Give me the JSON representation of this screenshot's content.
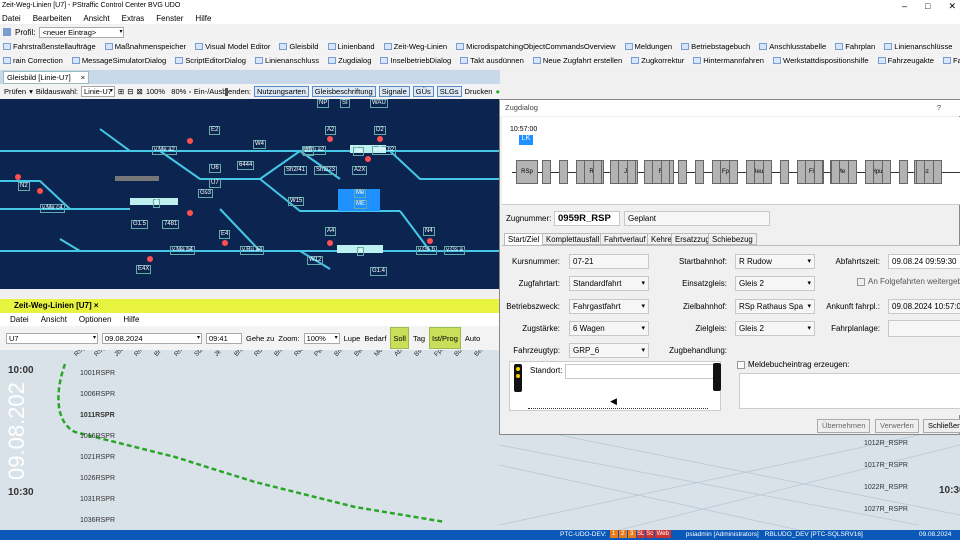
{
  "app": {
    "title": "Zeit-Weg-Linien [U7] - PStraffic Control Center BVG UDO"
  },
  "menubar": [
    "Datei",
    "Bearbeiten",
    "Ansicht",
    "Extras",
    "Fenster",
    "Hilfe"
  ],
  "profile": {
    "label": "Profil:",
    "value": "<neuer Eintrag>"
  },
  "toolbar1": [
    "Fahrstraßenstellaufträge",
    "Maßnahmenspeicher",
    "Visual Model Editor",
    "Gleisbild",
    "Linienband",
    "Zeit-Weg-Linien",
    "MicrodispatchingObjectCommandsOverview",
    "Meldungen",
    "Betriebstagebuch",
    "Anschlusstabelle",
    "Fahrplan",
    "Linienanschlüsse",
    "Linienübersicht",
    "Umlaufplan"
  ],
  "toolbar2": [
    "rain Correction",
    "MessageSimulatorDialog",
    "ScriptEditorDialog",
    "Linienanschluss",
    "Zugdialog",
    "InselbetriebDialog",
    "Takt ausdünnen",
    "Neue Zugfahrt erstellen",
    "Zugkorrektur",
    "Hintermannfahren",
    "Werkstattdispositionshilfe",
    "Fahrzeugakte",
    "Fahrzeugtyp",
    "Traktionstypmuster"
  ],
  "gleisbild": {
    "tab": "Gleisbild [Linie-U7]",
    "pruefen": "Prüfen",
    "bildauswahl_label": "Bildauswahl:",
    "bildauswahl": "Linie-U7",
    "zoom1": "100%",
    "zoom2": "80%",
    "einaus": "Ein-/Ausblenden:",
    "buttons": [
      "Nutzungsarten",
      "Gleisbeschriftung",
      "Signale",
      "GÜs",
      "SLGs"
    ],
    "drucken": "Drucken"
  },
  "track_labels": [
    "v.Me a2",
    "v.Ru a2",
    "v.Ru b2",
    "v.Me b4",
    "v.Ru a4",
    "v.Gs b",
    "v.Gs a",
    "v.Me c4",
    "2a",
    "2b",
    "4",
    "5",
    "Me",
    "ME",
    "W4",
    "W15",
    "W12",
    "Gs3",
    "Sh2/41",
    "Sh2/23",
    "A2X",
    "E2",
    "E4",
    "A2",
    "D2",
    "N2",
    "A4",
    "N4",
    "E4X",
    "U6",
    "U7",
    "6444",
    "7481",
    "G1.5",
    "G1.4",
    "NP",
    "SI",
    "WAU"
  ],
  "zwl": {
    "title": "Zeit-Weg-Linien [U7]",
    "menu": [
      "Datei",
      "Ansicht",
      "Optionen",
      "Hilfe"
    ],
    "line": "U7",
    "date": "09.08.2024",
    "time": "09:41",
    "gehe_zu": "Gehe zu",
    "zoom_label": "Zoom:",
    "zoom": "100%",
    "tools": [
      "Lupe",
      "Bedarf",
      "Soll",
      "Tag",
      "Ist/Prog",
      "Auto"
    ],
    "stations": [
      "RSp",
      "RSp",
      "Jbw",
      "Rmu",
      "Br",
      "Rn",
      "Sta",
      "Jk",
      "Bhf",
      "Rb",
      "Bmk",
      "Rw",
      "Pw",
      "Bmu",
      "Bw",
      "Mc",
      "Ab",
      "Bs",
      "Fpu",
      "Bu",
      "Beu"
    ],
    "date_big": "09.08.202",
    "time_marks": [
      "10:00",
      "10:30"
    ],
    "trains": [
      "1001RSPR",
      "1006RSPR",
      "1011RSPR",
      "1016RSPR",
      "1021RSPR",
      "1026RSPR",
      "1031RSPR",
      "1036RSPR"
    ],
    "right_trains": [
      "1012R_RSPR",
      "1017R_RSPR",
      "1022R_RSPR",
      "1027R_RSPR"
    ],
    "right_date": "09.08.2024",
    "right_time": "10:30"
  },
  "dialog": {
    "title": "Zugdialog",
    "time": "10:57:00",
    "badge": "LK",
    "route_stations": [
      "RSp",
      "Rs",
      "Jk",
      "Rw",
      "Fpu",
      "Beu",
      "Flu",
      "Me",
      "Hpu",
      "Gz"
    ],
    "zugnummer_label": "Zugnummer:",
    "zugnummer": "0959R_RSP",
    "status": "Geplant",
    "tabs": [
      "Start/Ziel",
      "Komplettausfall",
      "Fahrtverlauf",
      "Kehre",
      "Ersatzzug",
      "Schiebezug"
    ],
    "fields": {
      "kursnummer_l": "Kursnummer:",
      "kursnummer": "07-21",
      "zugfahrtart_l": "Zugfahrtart:",
      "zugfahrtart": "Standardfahrt",
      "betriebszweck_l": "Betriebszweck:",
      "betriebszweck": "Fahrgastfahrt",
      "zugstaerke_l": "Zugstärke:",
      "zugstaerke": "6 Wagen",
      "fahrzeugtyp_l": "Fahrzeugtyp:",
      "fahrzeugtyp": "GRP_6",
      "startbahnhof_l": "Startbahnhof:",
      "startbahnhof": "R  Rudow",
      "einsatzgleis_l": "Einsatzgleis:",
      "einsatzgleis": "Gleis 2",
      "zielbahnhof_l": "Zielbahnhof:",
      "zielbahnhof": "RSp  Rathaus Spa",
      "zielgleis_l": "Zielgleis:",
      "zielgleis": "Gleis 2",
      "zugbehandlung_l": "Zugbehandlung:",
      "abfahrtszeit_l": "Abfahrtszeit:",
      "abfahrtszeit": "09.08.24 09:59:30",
      "folgefahrten": "An Folgefahrten weitergeb",
      "ankunft_l": "Ankunft fahrpl.:",
      "ankunft": "09.08.2024 10:57:00",
      "fahrplanlage_l": "Fahrplanlage:",
      "standort_l": "Standort:",
      "meldebuch": "Meldebucheintrag erzeugen:"
    },
    "buttons": [
      "Übernehmen",
      "Verwerfen",
      "Schließen"
    ]
  },
  "status": {
    "items": [
      "PTC-UDO-DEV:",
      "psiadmin [Administrators]",
      "RBLUDO_DEV [PTC-SQLSRV16]",
      "09.08.2024"
    ],
    "squares": [
      "1",
      "2",
      "3",
      "SL",
      "Sc",
      "Web"
    ]
  },
  "colors": {
    "track": "#45c8e6",
    "bg_gleis": "#0b2550",
    "yellow": "#e7f33f",
    "green_line": "#2aa52a",
    "status": "#0a59b8"
  }
}
